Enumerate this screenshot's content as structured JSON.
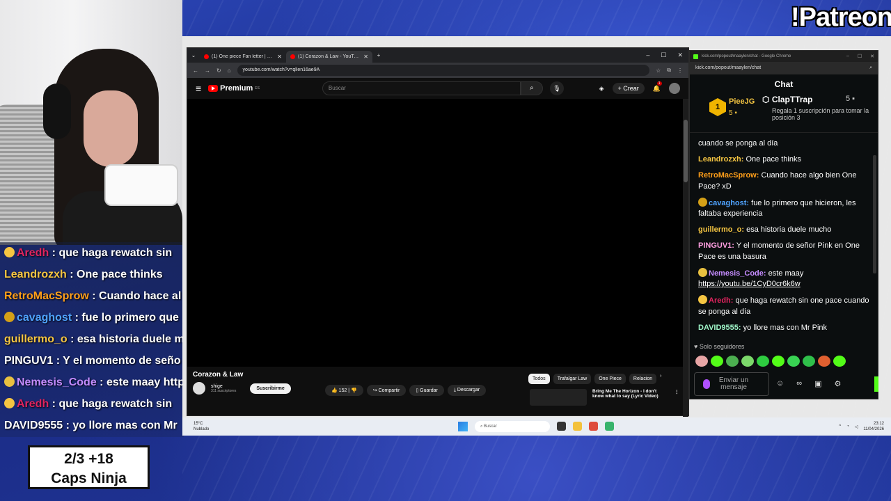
{
  "overlay": {
    "patreon": "!Patreon",
    "caps_line1": "2/3   +18",
    "caps_line2": "Caps Ninja",
    "chat": [
      {
        "user": "Aredh",
        "color": "#e0245e",
        "text": " : que haga rewatch sin"
      },
      {
        "user": "Leandrozxh",
        "color": "#f5c542",
        "text": " : One pace thinks"
      },
      {
        "user": "RetroMacSprow",
        "color": "#ff9f1a",
        "text": " : Cuando hace al"
      },
      {
        "user": "cavaghost",
        "color": "#4fa3ff",
        "text": " : fue lo primero que"
      },
      {
        "user": "guillermo_o",
        "color": "#f5c542",
        "text": " : esa historia duele m"
      },
      {
        "user": "PINGUV1",
        "color": "#ffffff",
        "text": " : Y el momento de seño"
      },
      {
        "user": "Nemesis_Code",
        "color": "#c58cff",
        "text": " : este maay http"
      },
      {
        "user": "Aredh",
        "color": "#e0245e",
        "text": " : que haga rewatch sin"
      },
      {
        "user": "DAVID9555",
        "color": "#ffffff",
        "text": " : yo llore mas con Mr"
      }
    ]
  },
  "browser": {
    "tabs": [
      {
        "title": "(1) One piece Fan letter | marin"
      },
      {
        "title": "(1) Corazon & Law - YouTube"
      }
    ],
    "url": "youtube.com/watch?v=qlien16ae9A",
    "logo": "Premium",
    "logo_region": "ES",
    "search_placeholder": "Buscar",
    "create_label": "Crear",
    "notif_count": "1",
    "video_title": "Corazon & Law",
    "channel_name": "shige",
    "channel_subs": "311 suscriptores",
    "subscribe_label": "Suscribirme",
    "likes": "152",
    "share_label": "Compartir",
    "save_label": "Guardar",
    "download_label": "Descargar",
    "chips": [
      "Todos",
      "Trafalgar Law",
      "One Piece",
      "Relacion"
    ],
    "rec_title": "Bring Me The Horizon - I don't know what to say (Lyric Video)"
  },
  "chat_window": {
    "title": "kick.com/popout/maaylen/chat - Google Chrome",
    "url": "kick.com/popout/maaylen/chat",
    "header": "Chat",
    "leader1_name": "PieeJG",
    "leader1_count": "5",
    "leader1_rank": "1",
    "leader2_name": "ClapTTrap",
    "leader2_count": "5",
    "leader2_text": "Regala 1 suscripción para tomar la posición 3",
    "messages": [
      {
        "user": "",
        "color": "#fff",
        "text": "cuando se ponga al día"
      },
      {
        "user": "Leandrozxh:",
        "color": "#f5c542",
        "text": " One pace thinks"
      },
      {
        "user": "RetroMacSprow:",
        "color": "#ff9f1a",
        "text": " Cuando hace algo bien One Pace? xD"
      },
      {
        "user": "cavaghost:",
        "color": "#4fa3ff",
        "text": " fue lo primero que hicieron, les faltaba experiencia"
      },
      {
        "user": "guillermo_o:",
        "color": "#f5c542",
        "text": " esa historia duele mucho"
      },
      {
        "user": "PINGUV1:",
        "color": "#ff9ee0",
        "text": " Y el momento de señor Pink en One Pace es una basura"
      },
      {
        "user": "Nemesis_Code:",
        "color": "#c58cff",
        "text": " este maay",
        "link": "https://youtu.be/1CyD0cr6k6w"
      },
      {
        "user": "Aredh:",
        "color": "#e0245e",
        "text": " que haga rewatch sin one pace cuando se ponga al día"
      },
      {
        "user": "DAVID9555:",
        "color": "#9ff5c8",
        "text": " yo llore mas con Mr Pink"
      }
    ],
    "followers_only": "Solo seguidores",
    "input_placeholder": "Enviar un mensaje"
  },
  "taskbar": {
    "temp": "15°C",
    "weather": "Nublado",
    "search": "Buscar",
    "time": "23:12",
    "date": "11/04/2026"
  }
}
